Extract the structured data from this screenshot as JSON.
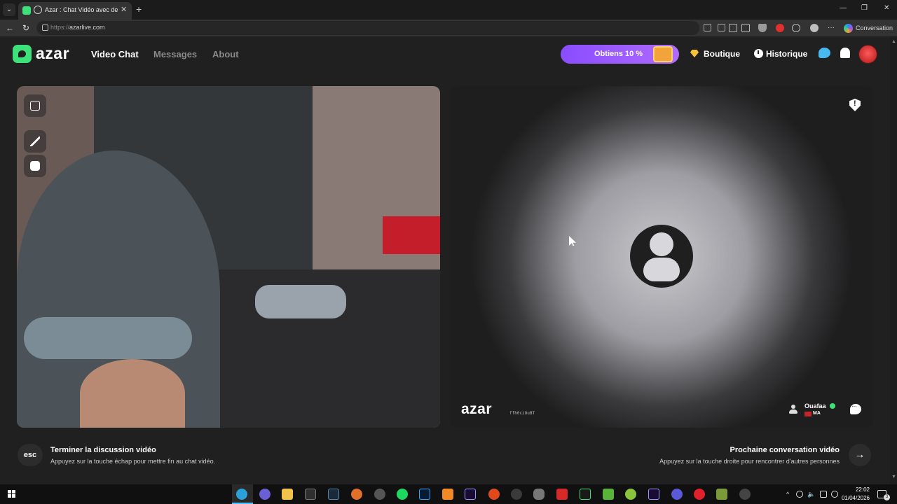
{
  "browser": {
    "tab_title": "Azar : Chat Vidéo avec de nou",
    "tab_close": "✕",
    "new_tab": "+",
    "url_scheme": "https://",
    "url_host": "azarlive.com",
    "conversation_label": "Conversation",
    "window_minimize": "—",
    "window_maximize": "❐",
    "window_close": "✕",
    "nav_back": "←",
    "nav_reload": "↻",
    "more_menu": "···"
  },
  "header": {
    "logo_text": "azar",
    "nav": [
      "Video Chat",
      "Messages",
      "About"
    ],
    "promo_label": "Obtiens 10 %",
    "shop_label": "Boutique",
    "history_label": "Historique"
  },
  "remote": {
    "watermark": "azar",
    "watermark_id": "ffh0czOuBT",
    "partner_name": "Ouafaa",
    "partner_country": "MA"
  },
  "footer": {
    "esc_key": "esc",
    "end_title": "Terminer la discussion vidéo",
    "end_desc": "Appuyez sur la touche échap pour mettre fin au chat vidéo.",
    "next_title": "Prochaine conversation vidéo",
    "next_desc": "Appuyez sur la touche droite pour rencontrer d'autres personnes",
    "next_arrow": "→"
  },
  "taskbar": {
    "time": "22:02",
    "date": "01/04/2026",
    "notification_count": "3",
    "tray_chevron": "^",
    "volume": "🔈"
  },
  "colors": {
    "accent_green": "#3ee07a",
    "promo_purple": "#8a4dff",
    "background": "#202020"
  }
}
